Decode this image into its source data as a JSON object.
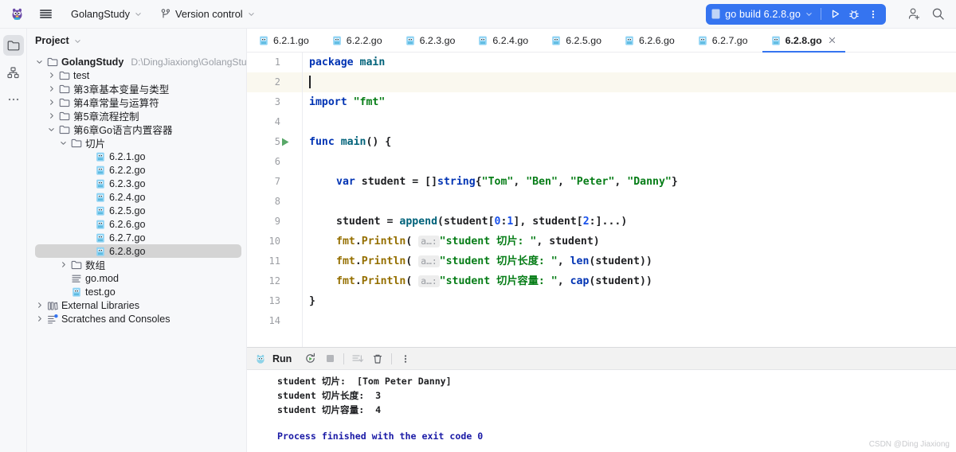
{
  "titlebar": {
    "logo_icon": "goland-gopher-logo",
    "menu_icon": "hamburger-menu-icon",
    "project_name": "GolangStudy",
    "vcs_label": "Version control",
    "vcs_icon": "branch-icon",
    "chevron_icon": "chevron-down-icon",
    "run_config_label": "go build 6.2.8.go",
    "run_config_icon": "go-file-icon",
    "run_icon": "run-triangle-icon",
    "debug_icon": "debug-bug-icon",
    "more_icon": "more-vertical-icon",
    "account_icon": "add-user-icon",
    "search_icon": "search-icon",
    "accent_blue": "#3574F0"
  },
  "rail": {
    "items": [
      {
        "name": "project-folder-icon",
        "active": true
      },
      {
        "name": "structure-icon",
        "active": false
      },
      {
        "name": "more-horizontal-icon",
        "active": false
      }
    ]
  },
  "project": {
    "header_title": "Project",
    "header_chevron": "chevron-down-icon",
    "tree": [
      {
        "indent": 0,
        "arrow": "down",
        "icon": "folder-icon",
        "label": "GolangStudy",
        "bold": true,
        "path": "D:\\DingJiaxiong\\GolangStudy",
        "selected": false
      },
      {
        "indent": 1,
        "arrow": "right",
        "icon": "folder-icon",
        "label": "test",
        "bold": false,
        "path": "",
        "selected": false
      },
      {
        "indent": 1,
        "arrow": "right",
        "icon": "folder-icon",
        "label": "第3章基本变量与类型",
        "bold": false,
        "path": "",
        "selected": false
      },
      {
        "indent": 1,
        "arrow": "right",
        "icon": "folder-icon",
        "label": "第4章常量与运算符",
        "bold": false,
        "path": "",
        "selected": false
      },
      {
        "indent": 1,
        "arrow": "right",
        "icon": "folder-icon",
        "label": "第5章流程控制",
        "bold": false,
        "path": "",
        "selected": false
      },
      {
        "indent": 1,
        "arrow": "down",
        "icon": "folder-icon",
        "label": "第6章Go语言内置容器",
        "bold": false,
        "path": "",
        "selected": false
      },
      {
        "indent": 2,
        "arrow": "down",
        "icon": "folder-icon",
        "label": "切片",
        "bold": false,
        "path": "",
        "selected": false
      },
      {
        "indent": 4,
        "arrow": "none",
        "icon": "go-file-icon",
        "label": "6.2.1.go",
        "bold": false,
        "path": "",
        "selected": false
      },
      {
        "indent": 4,
        "arrow": "none",
        "icon": "go-file-icon",
        "label": "6.2.2.go",
        "bold": false,
        "path": "",
        "selected": false
      },
      {
        "indent": 4,
        "arrow": "none",
        "icon": "go-file-icon",
        "label": "6.2.3.go",
        "bold": false,
        "path": "",
        "selected": false
      },
      {
        "indent": 4,
        "arrow": "none",
        "icon": "go-file-icon",
        "label": "6.2.4.go",
        "bold": false,
        "path": "",
        "selected": false
      },
      {
        "indent": 4,
        "arrow": "none",
        "icon": "go-file-icon",
        "label": "6.2.5.go",
        "bold": false,
        "path": "",
        "selected": false
      },
      {
        "indent": 4,
        "arrow": "none",
        "icon": "go-file-icon",
        "label": "6.2.6.go",
        "bold": false,
        "path": "",
        "selected": false
      },
      {
        "indent": 4,
        "arrow": "none",
        "icon": "go-file-icon",
        "label": "6.2.7.go",
        "bold": false,
        "path": "",
        "selected": false
      },
      {
        "indent": 4,
        "arrow": "none",
        "icon": "go-file-icon",
        "label": "6.2.8.go",
        "bold": false,
        "path": "",
        "selected": true
      },
      {
        "indent": 2,
        "arrow": "right",
        "icon": "folder-icon",
        "label": "数组",
        "bold": false,
        "path": "",
        "selected": false
      },
      {
        "indent": 2,
        "arrow": "none",
        "icon": "modfile-icon",
        "label": "go.mod",
        "bold": false,
        "path": "",
        "selected": false
      },
      {
        "indent": 2,
        "arrow": "none",
        "icon": "go-file-icon",
        "label": "test.go",
        "bold": false,
        "path": "",
        "selected": false
      },
      {
        "indent": 0,
        "arrow": "right",
        "icon": "library-icon",
        "label": "External Libraries",
        "bold": false,
        "path": "",
        "selected": false
      },
      {
        "indent": 0,
        "arrow": "right",
        "icon": "scratches-icon",
        "label": "Scratches and Consoles",
        "bold": false,
        "path": "",
        "selected": false
      }
    ]
  },
  "editor": {
    "tabs": [
      {
        "label": "6.2.1.go",
        "active": false
      },
      {
        "label": "6.2.2.go",
        "active": false
      },
      {
        "label": "6.2.3.go",
        "active": false
      },
      {
        "label": "6.2.4.go",
        "active": false
      },
      {
        "label": "6.2.5.go",
        "active": false
      },
      {
        "label": "6.2.6.go",
        "active": false
      },
      {
        "label": "6.2.7.go",
        "active": false
      },
      {
        "label": "6.2.8.go",
        "active": true
      }
    ],
    "tab_close_icon": "close-icon",
    "tab_file_icon": "go-file-icon",
    "line_numbers": [
      "1",
      "2",
      "3",
      "4",
      "5",
      "6",
      "7",
      "8",
      "9",
      "10",
      "11",
      "12",
      "13",
      "14"
    ],
    "caret_line": 2,
    "gutter_run_line": 5,
    "gutter_run_icon": "run-triangle-icon",
    "inlay_hint": "a…:",
    "lines": {
      "l1_package": "package",
      "l1_main": "main",
      "l3_import": "import",
      "l3_fmt": "\"fmt\"",
      "l5_func": "func",
      "l5_name": "main",
      "l5_tail": "() {",
      "l7_var": "var",
      "l7_ident": " student = []",
      "l7_string": "string",
      "l7_brace": "{",
      "l7_s1": "\"Tom\"",
      "l7_c1": ", ",
      "l7_s2": "\"Ben\"",
      "l7_c2": ", ",
      "l7_s3": "\"Peter\"",
      "l7_c3": ", ",
      "l7_s4": "\"Danny\"",
      "l7_end": "}",
      "l9_a": "student = ",
      "l9_append": "append",
      "l9_b": "(student[",
      "l9_n1": "0",
      "l9_c": ":",
      "l9_n2": "1",
      "l9_d": "], student[",
      "l9_n3": "2",
      "l9_e": ":]...)",
      "l10_fmt": "fmt",
      "l10_dot": ".",
      "l10_println": "Println",
      "l10_open": "(",
      "l10_str": "\"student 切片: \"",
      "l10_tail": ", student)",
      "l11_str": "\"student 切片长度: \"",
      "l11_mid": ", ",
      "l11_len": "len",
      "l11_tail": "(student))",
      "l12_str": "\"student 切片容量: \"",
      "l12_cap": "cap",
      "l12_tail": "(student))",
      "l13_close": "}"
    }
  },
  "run_panel": {
    "icon": "gopher-icon",
    "title": "Run",
    "buttons": [
      {
        "name": "rerun-icon"
      },
      {
        "name": "stop-icon"
      },
      {
        "name": "scroll-to-end-icon"
      },
      {
        "name": "trash-icon"
      },
      {
        "name": "more-vertical-icon"
      }
    ],
    "console": [
      {
        "text": "student 切片:  [Tom Peter Danny]",
        "kind": "out"
      },
      {
        "text": "student 切片长度:  3",
        "kind": "out"
      },
      {
        "text": "student 切片容量:  4",
        "kind": "out"
      },
      {
        "text": "Process finished with the exit code 0",
        "kind": "exit"
      }
    ]
  },
  "watermark": "CSDN @Ding Jiaxiong"
}
